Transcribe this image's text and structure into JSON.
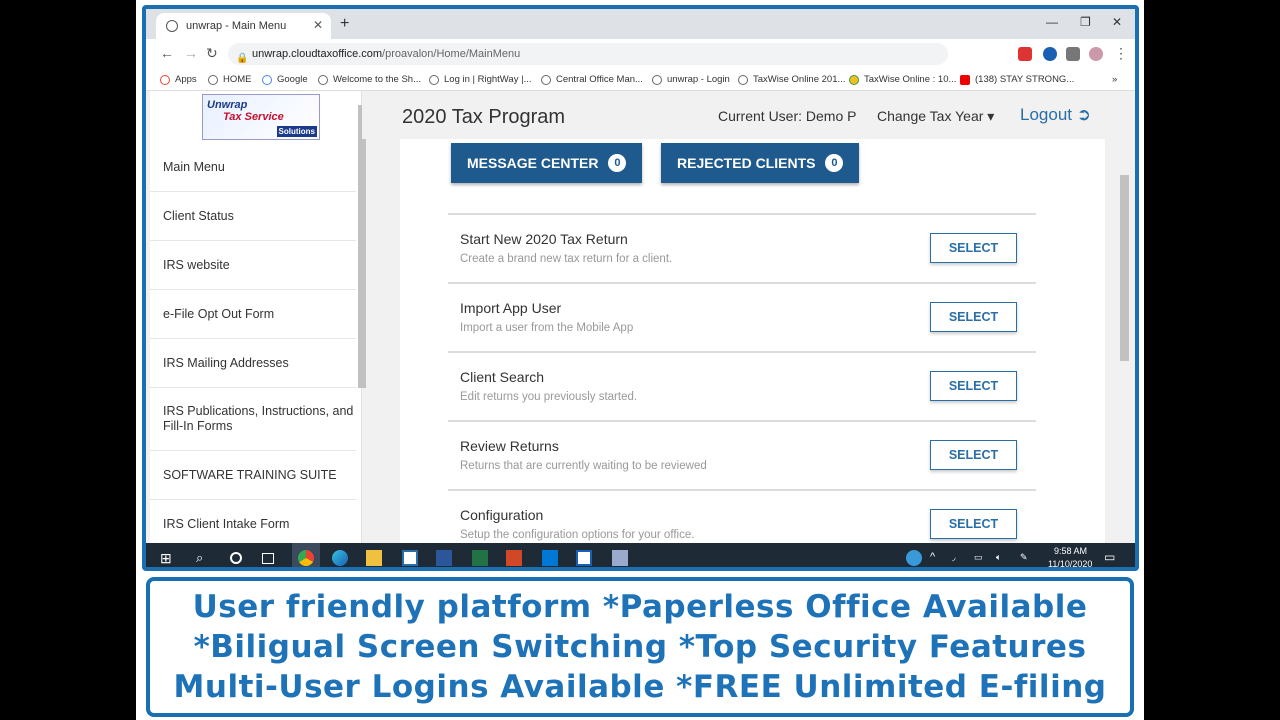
{
  "browser": {
    "tab_title": "unwrap - Main Menu",
    "tab_close": "✕",
    "new_tab": "+",
    "url_domain": "unwrap.cloudtaxoffice.com",
    "url_path": "/proavalon/Home/MainMenu",
    "min": "—",
    "max": "❐",
    "close": "✕",
    "back": "←",
    "forward": "→",
    "reload": "↻",
    "menu": "⋮"
  },
  "bookmarks": [
    {
      "label": "Apps",
      "color": "#ea4335"
    },
    {
      "label": "HOME",
      "color": "#444"
    },
    {
      "label": "Google",
      "color": "#4285f4"
    },
    {
      "label": "Welcome to the Sh...",
      "color": "#444"
    },
    {
      "label": "Log in | RightWay |...",
      "color": "#444"
    },
    {
      "label": "Central Office Man...",
      "color": "#444"
    },
    {
      "label": "unwrap - Login",
      "color": "#444"
    },
    {
      "label": "TaxWise Online 201...",
      "color": "#444"
    },
    {
      "label": "TaxWise Online : 10...",
      "color": "#3c9a3c"
    },
    {
      "label": "(138) STAY STRONG...",
      "color": "#e00"
    }
  ],
  "bookmarks_more": "»",
  "logo": {
    "line1": "Unwrap",
    "line2": "Tax Service",
    "line3": "Solutions"
  },
  "sidebar": {
    "items": [
      {
        "label": "Main Menu"
      },
      {
        "label": "Client Status"
      },
      {
        "label": "IRS website"
      },
      {
        "label": "e-File Opt Out Form"
      },
      {
        "label": "IRS Mailing Addresses"
      },
      {
        "label": "IRS Publications, Instructions, and Fill-In Forms"
      },
      {
        "label": "SOFTWARE TRAINING SUITE"
      },
      {
        "label": "IRS Client Intake Form"
      }
    ]
  },
  "header": {
    "title": "2020 Tax Program",
    "current_user": "Current User: Demo P",
    "change_year": "Change Tax Year ▾",
    "logout": "Logout ➲"
  },
  "buttons": {
    "message_center": "MESSAGE CENTER",
    "message_count": "0",
    "rejected_clients": "REJECTED CLIENTS",
    "rejected_count": "0"
  },
  "menu": [
    {
      "title": "Start New 2020 Tax Return",
      "desc": "Create a brand new tax return for a client.",
      "action": "SELECT"
    },
    {
      "title": "Import App User",
      "desc": "Import a user from the Mobile App",
      "action": "SELECT"
    },
    {
      "title": "Client Search",
      "desc": "Edit returns you previously started.",
      "action": "SELECT"
    },
    {
      "title": "Review Returns",
      "desc": "Returns that are currently waiting to be reviewed",
      "action": "SELECT"
    },
    {
      "title": "Configuration",
      "desc": "Setup the configuration options for your office.",
      "action": "SELECT"
    }
  ],
  "taskbar": {
    "time": "9:58 AM",
    "date": "11/10/2020"
  },
  "promo": [
    "User friendly platform *Paperless Office Available",
    "*Biligual Screen Switching *Top Security Features",
    "Multi-User Logins Available *FREE Unlimited E-filing"
  ],
  "colors": {
    "accent": "#1d72b8",
    "button": "#1e5a8e"
  }
}
